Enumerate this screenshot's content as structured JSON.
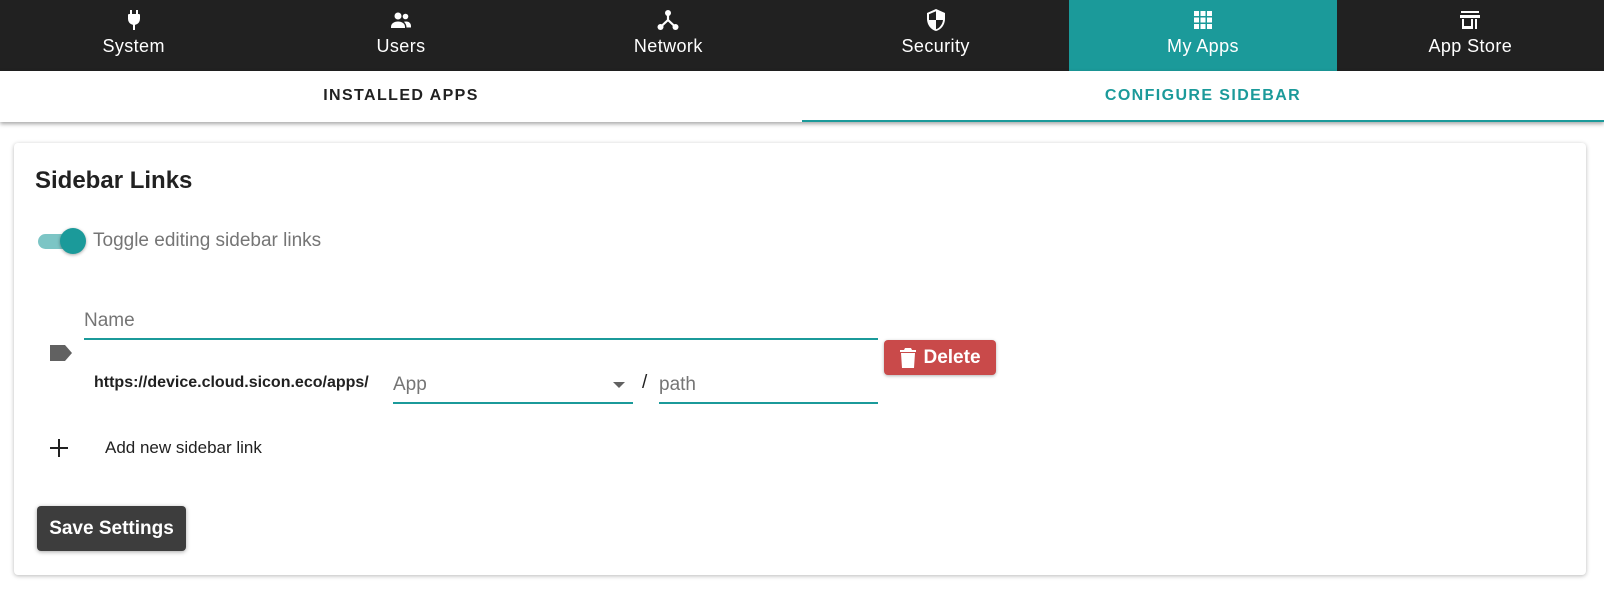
{
  "colors": {
    "accent": "#1b9a9a",
    "nav_background": "#212121",
    "delete": "#c94a4a",
    "save_button": "#3d3d3d"
  },
  "topnav": {
    "items": [
      {
        "label": "System",
        "icon": "plug-icon",
        "active": false
      },
      {
        "label": "Users",
        "icon": "users-icon",
        "active": false
      },
      {
        "label": "Network",
        "icon": "network-icon",
        "active": false
      },
      {
        "label": "Security",
        "icon": "shield-icon",
        "active": false
      },
      {
        "label": "My Apps",
        "icon": "apps-grid-icon",
        "active": true
      },
      {
        "label": "App Store",
        "icon": "store-icon",
        "active": false
      }
    ]
  },
  "subtabs": {
    "items": [
      {
        "label": "INSTALLED APPS",
        "active": false
      },
      {
        "label": "CONFIGURE SIDEBAR",
        "active": true
      }
    ]
  },
  "sidebar_links": {
    "title": "Sidebar Links",
    "toggle_label": "Toggle editing sidebar links",
    "toggle_on": true,
    "link": {
      "name_placeholder": "Name",
      "url_prefix": "https://device.cloud.sicon.eco/apps/",
      "app_placeholder": "App",
      "separator": "/",
      "path_placeholder": "path",
      "delete_label": "Delete"
    },
    "add_label": "Add new sidebar link",
    "save_label": "Save Settings"
  }
}
